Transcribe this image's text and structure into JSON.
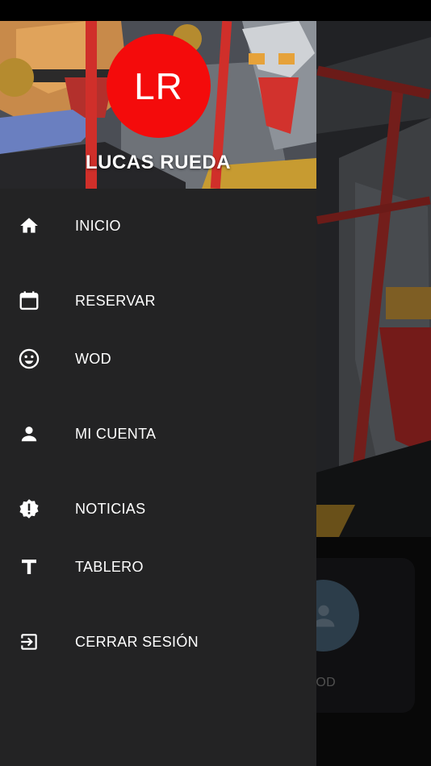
{
  "drawer": {
    "user": {
      "initials": "LR",
      "name": "LUCAS RUEDA"
    },
    "items": [
      {
        "label": "INICIO",
        "icon": "home-icon"
      },
      {
        "label": "RESERVAR",
        "icon": "calendar-icon"
      },
      {
        "label": "WOD",
        "icon": "smiley-icon"
      },
      {
        "label": "MI CUENTA",
        "icon": "person-icon"
      },
      {
        "label": "NOTICIAS",
        "icon": "alert-badge-icon"
      },
      {
        "label": "TABLERO",
        "icon": "text-t-icon"
      },
      {
        "label": "CERRAR SESIÓN",
        "icon": "logout-icon"
      }
    ]
  },
  "background": {
    "card_label": "WOD"
  },
  "colors": {
    "drawer_bg": "#232324",
    "avatar_bg": "#f40b0b",
    "text": "#ffffff"
  }
}
